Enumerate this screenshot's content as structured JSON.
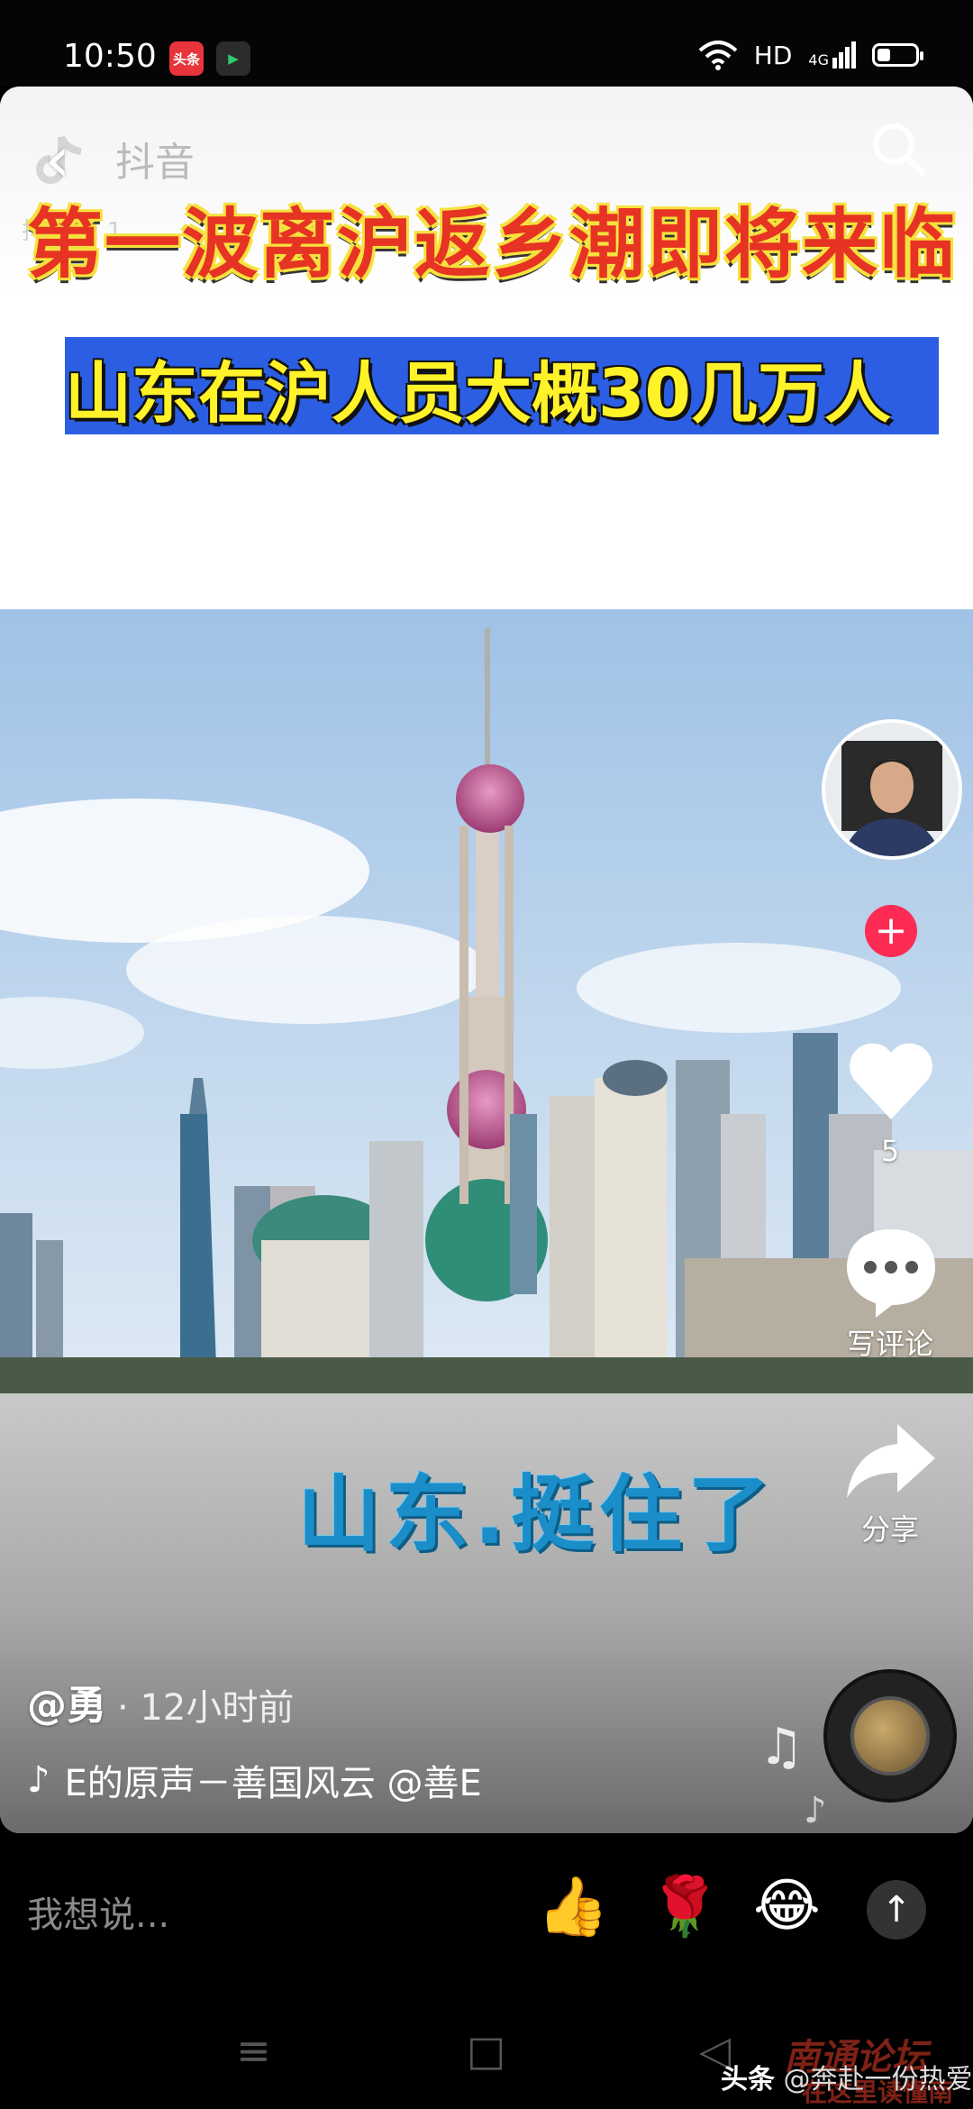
{
  "status_bar": {
    "time": "10:50",
    "app1": "头条",
    "app2": "▶",
    "network": "HD",
    "network_gen": "4G"
  },
  "video": {
    "watermark_brand": "抖音",
    "watermark_id": "抖音号: 1...",
    "headline": "第一波离沪返乡潮即将来临",
    "subline": "山东在沪人员大概30几万人",
    "caption": "山东.挺住了"
  },
  "rail": {
    "like_count": "5",
    "comment_label": "写评论",
    "share_label": "分享",
    "follow_symbol": "+"
  },
  "post": {
    "author": "@勇",
    "time_ago": "· 12小时前",
    "music_text": "E的原声－善国风云    @善E"
  },
  "comment_bar": {
    "placeholder": "我想说...",
    "emojis": [
      "👍",
      "🌹",
      "😂"
    ],
    "send_symbol": "↑"
  },
  "credit": {
    "source": "头条",
    "handle": "@奔赴一份热爱"
  },
  "site_watermark": {
    "line1": "南通论坛",
    "line2": "在这里读懂南通"
  },
  "colors": {
    "headline_red": "#e63323",
    "subline_bar_blue": "#2b5ee3",
    "subline_yellow": "#fff229",
    "caption_blue": "#1b8ec9",
    "follow_red": "#fe2c55"
  }
}
